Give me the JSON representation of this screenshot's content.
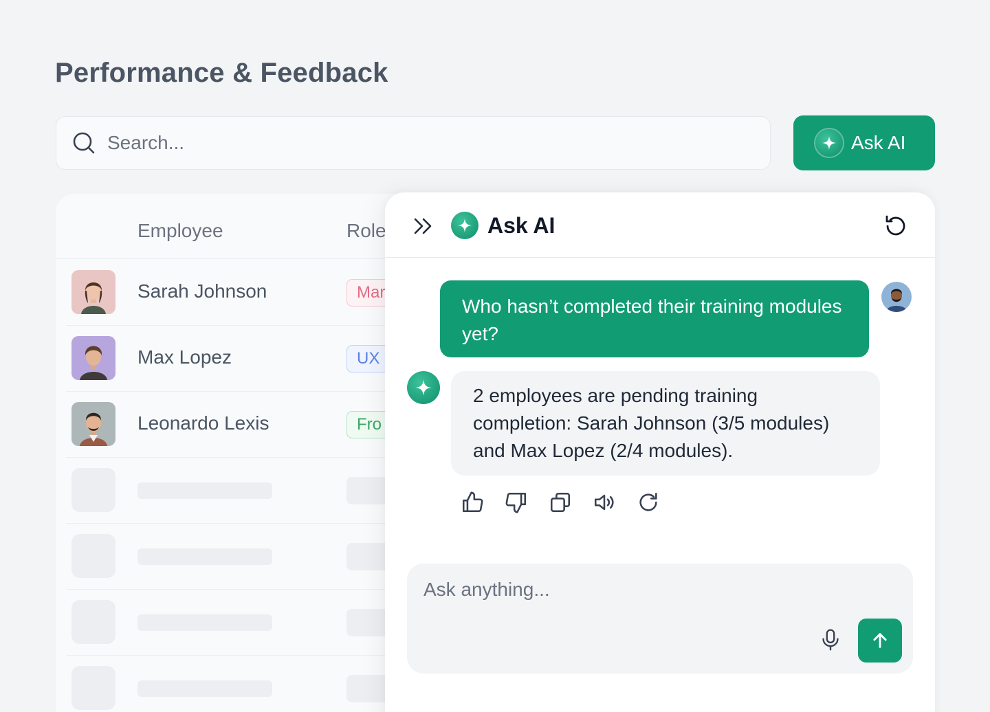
{
  "page": {
    "title": "Performance & Feedback"
  },
  "search": {
    "placeholder": "Search..."
  },
  "toolbar": {
    "ask_ai_label": "Ask AI"
  },
  "colors": {
    "accent": "#129c74",
    "accent_light": "#3cc29c"
  },
  "table": {
    "columns": [
      "Employee",
      "Role"
    ],
    "rows": [
      {
        "name": "Sarah Johnson",
        "role": "Mar",
        "badge": "pink"
      },
      {
        "name": "Max Lopez",
        "role": "UX",
        "badge": "blue"
      },
      {
        "name": "Leonardo Lexis",
        "role": "Fro",
        "badge": "green"
      }
    ],
    "skeleton_rows": 4
  },
  "ai_panel": {
    "title": "Ask AI",
    "user_message": "Who hasn’t completed their training modules yet?",
    "ai_message": "2 employees are pending training completion: Sarah Johnson (3/5 modules) and Max Lopez (2/4 modules).",
    "actions": [
      "thumbs-up-icon",
      "thumbs-down-icon",
      "copy-icon",
      "speaker-icon",
      "regenerate-icon"
    ],
    "composer_placeholder": "Ask anything..."
  }
}
